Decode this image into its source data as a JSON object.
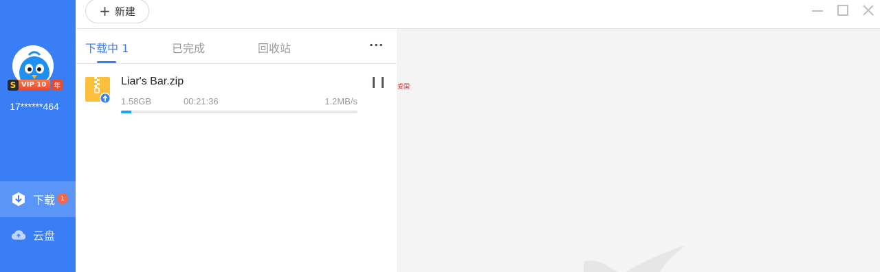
{
  "sidebar": {
    "avatar_icon": "bird-avatar-icon",
    "vip": {
      "s_label": "S",
      "label": "VIP 10",
      "suffix": "年"
    },
    "username": "17******464",
    "nav": [
      {
        "label": "下载",
        "icon": "download-icon",
        "badge": "1",
        "active": true
      },
      {
        "label": "云盘",
        "icon": "cloud-icon",
        "active": false
      }
    ]
  },
  "toolbar": {
    "new_label": "新建",
    "new_icon": "plus-icon"
  },
  "tabs": [
    {
      "label": "下载中 1",
      "active": true
    },
    {
      "label": "已完成",
      "active": false
    },
    {
      "label": "回收站",
      "active": false
    }
  ],
  "more_label": "···",
  "tasks": [
    {
      "name": "Liar's Bar.zip",
      "size": "1.58GB",
      "remaining": "00:21:36",
      "speed": "1.2MB/s",
      "progress": 0.045,
      "icon": "zip-file-icon"
    }
  ],
  "right_pane": {
    "note": "爱国"
  },
  "colors": {
    "sidebar": "#3a7ef6",
    "accent": "#3a7ef6",
    "progress": "#1aa3f5"
  }
}
